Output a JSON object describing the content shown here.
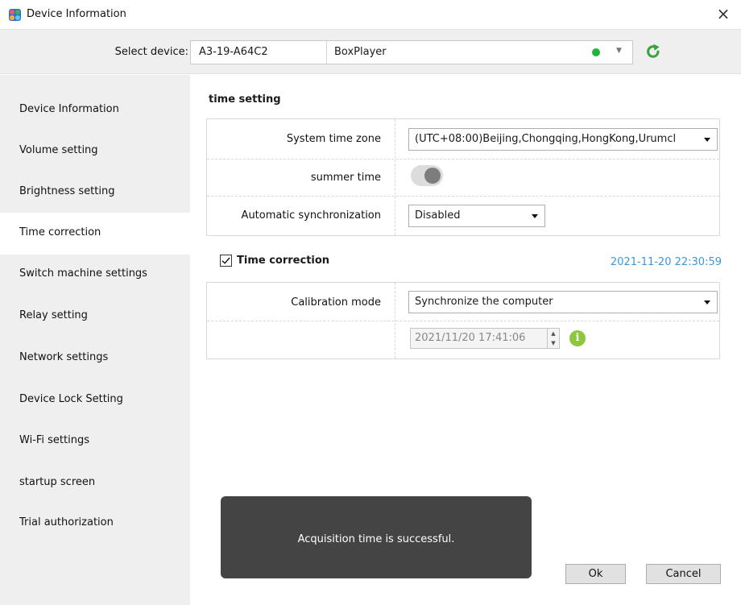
{
  "window": {
    "title": "Device Information",
    "close_glyph": "×"
  },
  "device_bar": {
    "label": "Select device:",
    "device_id": "A3-19-A64C2",
    "device_name": "BoxPlayer",
    "status_color": "#1eb53a"
  },
  "sidebar": {
    "items": [
      {
        "label": "Device Information"
      },
      {
        "label": "Volume setting"
      },
      {
        "label": "Brightness setting"
      },
      {
        "label": "Time correction",
        "active": true
      },
      {
        "label": "Switch machine settings"
      },
      {
        "label": "Relay setting"
      },
      {
        "label": "Network settings"
      },
      {
        "label": "Device Lock Setting"
      },
      {
        "label": "Wi-Fi settings"
      },
      {
        "label": "startup screen"
      },
      {
        "label": "Trial authorization"
      }
    ]
  },
  "time_setting": {
    "title": "time setting",
    "timezone_label": "System time zone",
    "timezone_value": "(UTC+08:00)Beijing,Chongqing,HongKong,Urumcl",
    "summer_label": "summer time",
    "auto_sync_label": "Automatic synchronization",
    "auto_sync_value": "Disabled"
  },
  "time_correction": {
    "label": "Time correction",
    "checked": true,
    "device_time": "2021-11-20 22:30:59",
    "mode_label": "Calibration mode",
    "mode_value": "Synchronize the computer",
    "datetime_value": "2021/11/20 17:41:06",
    "spin_up": "▲",
    "spin_down": "▼",
    "info_glyph": "i"
  },
  "toast": {
    "message": "Acquisition time is successful."
  },
  "buttons": {
    "ok": "Ok",
    "cancel": "Cancel"
  },
  "icons": {
    "app": "app-logo-icon",
    "close": "close-icon",
    "refresh": "refresh-icon",
    "info": "info-icon",
    "dropdown": "chevron-down-icon"
  },
  "colors": {
    "accent_blue": "#3a97dc",
    "refresh_green": "#3aa23a",
    "info_green": "#8dc63f",
    "toast_bg": "#444444"
  }
}
